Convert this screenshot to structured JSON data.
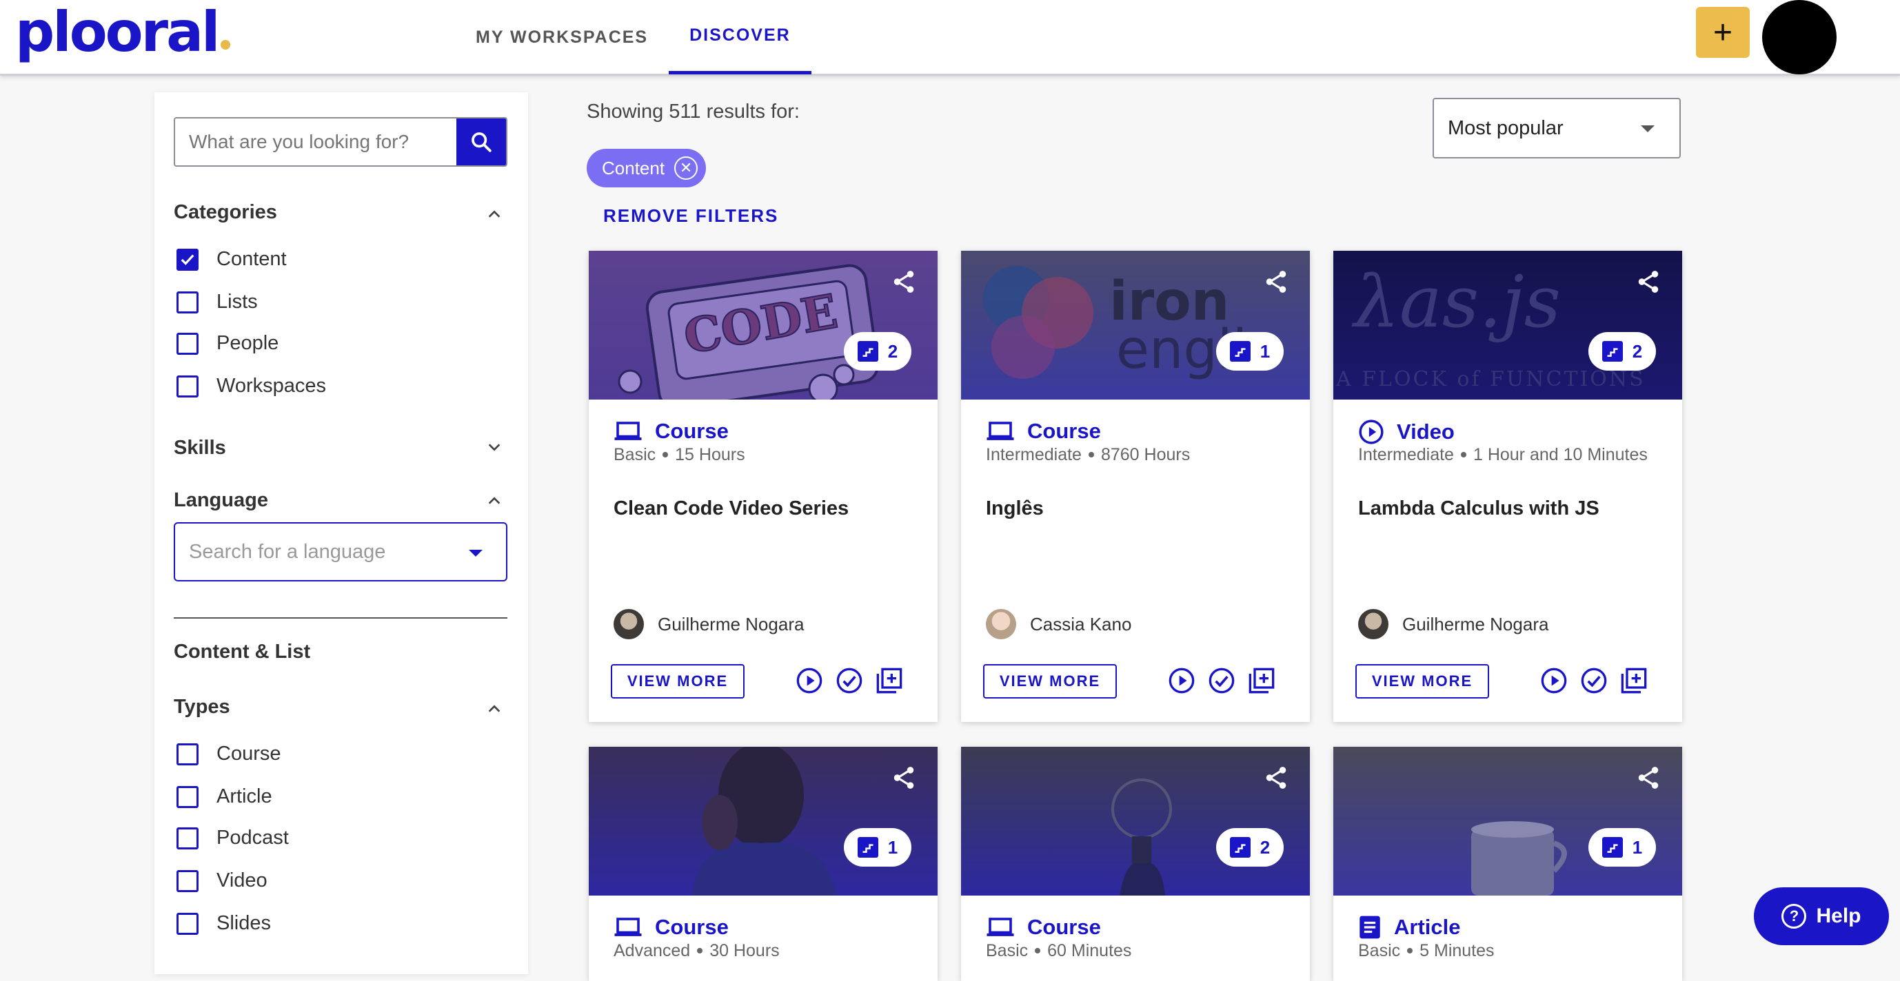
{
  "brand": {
    "logo_text": "plooral",
    "logo_left": "pl",
    "logo_mid": "oo",
    "logo_right": "ral",
    "accent": "#1a16c7",
    "yellow": "#ecbd4c"
  },
  "nav": {
    "tabs": [
      {
        "label": "MY WORKSPACES"
      },
      {
        "label": "DISCOVER"
      }
    ],
    "active": "DISCOVER"
  },
  "header": {
    "plus_label": "+"
  },
  "sidebar": {
    "search_placeholder": "What are you looking for?",
    "categories": {
      "title": "Categories",
      "items": [
        {
          "label": "Content",
          "checked": true
        },
        {
          "label": "Lists",
          "checked": false
        },
        {
          "label": "People",
          "checked": false
        },
        {
          "label": "Workspaces",
          "checked": false
        }
      ]
    },
    "skills": {
      "title": "Skills"
    },
    "language": {
      "title": "Language",
      "placeholder": "Search for a language"
    },
    "content_list_title": "Content & List",
    "types": {
      "title": "Types",
      "items": [
        {
          "label": "Course",
          "checked": false
        },
        {
          "label": "Article",
          "checked": false
        },
        {
          "label": "Podcast",
          "checked": false
        },
        {
          "label": "Video",
          "checked": false
        },
        {
          "label": "Slides",
          "checked": false
        }
      ]
    }
  },
  "results": {
    "text": "Showing 511 results for:",
    "chip": "Content",
    "remove_filters": "REMOVE FILTERS",
    "sort": "Most popular"
  },
  "cards": [
    {
      "type": "Course",
      "icon": "laptop-icon",
      "level": "Basic",
      "duration": "15 Hours",
      "title": "Clean Code Video Series",
      "author": "Guilherme Nogara",
      "steps": "2",
      "view_more": "VIEW MORE",
      "image_text": "CODE"
    },
    {
      "type": "Course",
      "icon": "laptop-icon",
      "level": "Intermediate",
      "duration": "8760 Hours",
      "title": "Inglês",
      "author": "Cassia Kano",
      "steps": "1",
      "view_more": "VIEW MORE",
      "image_text_1": "iron",
      "image_text_2": "engli"
    },
    {
      "type": "Video",
      "icon": "play-circle-icon",
      "level": "Intermediate",
      "duration": "1 Hour and 10 Minutes",
      "title": "Lambda Calculus with JS",
      "author": "Guilherme Nogara",
      "steps": "2",
      "view_more": "VIEW MORE",
      "image_text_1": "λas.js",
      "image_text_2": "A FLOCK of FUNCTIONS"
    },
    {
      "type": "Course",
      "icon": "laptop-icon",
      "level": "Advanced",
      "duration": "30 Hours",
      "steps": "1"
    },
    {
      "type": "Course",
      "icon": "laptop-icon",
      "level": "Basic",
      "duration": "60 Minutes",
      "steps": "2"
    },
    {
      "type": "Article",
      "icon": "article-icon",
      "level": "Basic",
      "duration": "5 Minutes",
      "steps": "1"
    }
  ],
  "help": {
    "label": "Help",
    "glyph": "?"
  }
}
